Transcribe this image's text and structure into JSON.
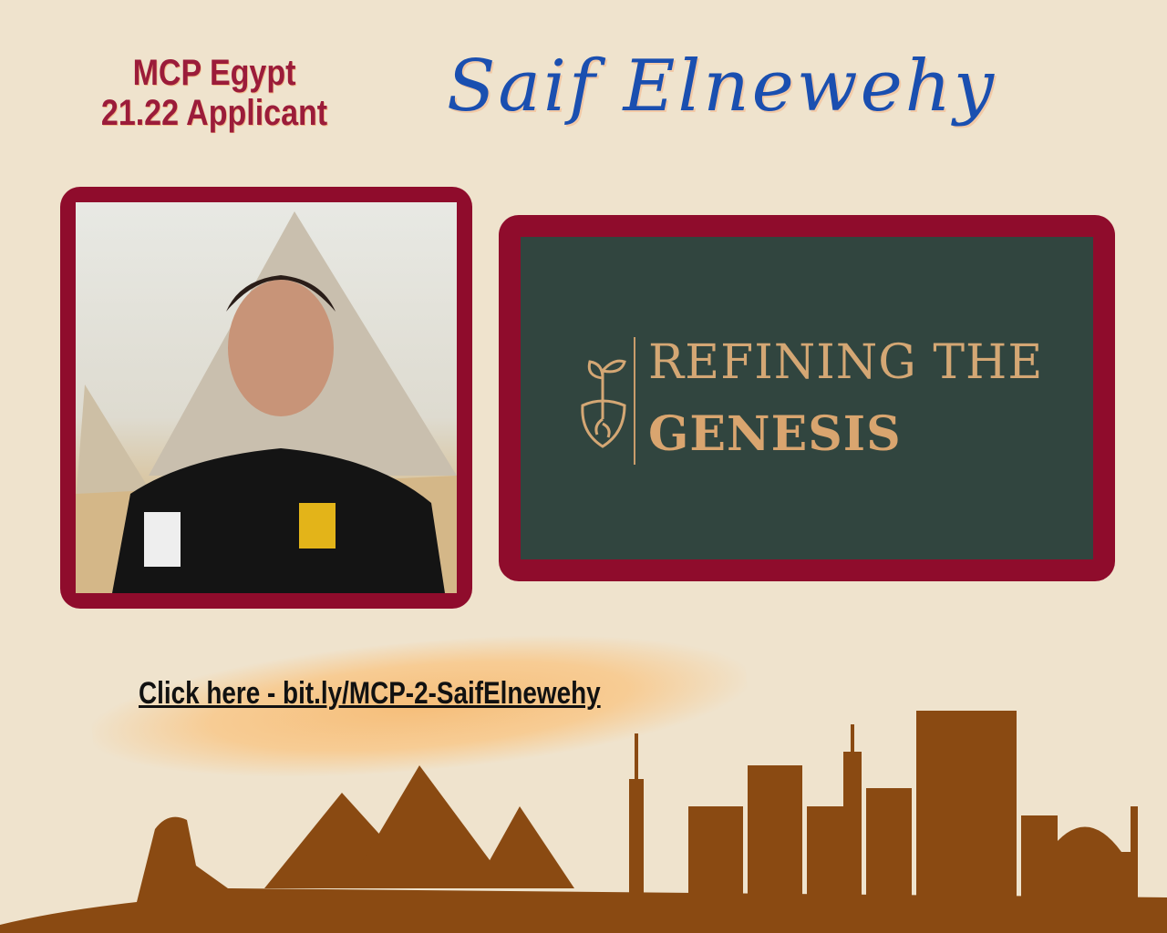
{
  "header": {
    "subtitle_line1": "MCP Egypt",
    "subtitle_line2": "21.22 Applicant",
    "name": "Saif Elnewehy"
  },
  "logo": {
    "line1": "REFINING THE",
    "line2": "GENESIS",
    "icon": "sprout-shield-icon"
  },
  "link": {
    "label": "Click here - bit.ly/MCP-2-SaifElnewehy"
  },
  "colors": {
    "background": "#efe3cd",
    "frame": "#8f0c2c",
    "logo_bg": "#31453f",
    "logo_text": "#d4a774",
    "name": "#1a4fb0",
    "subtitle": "#9b1c3a",
    "skyline": "#8a4a12"
  }
}
